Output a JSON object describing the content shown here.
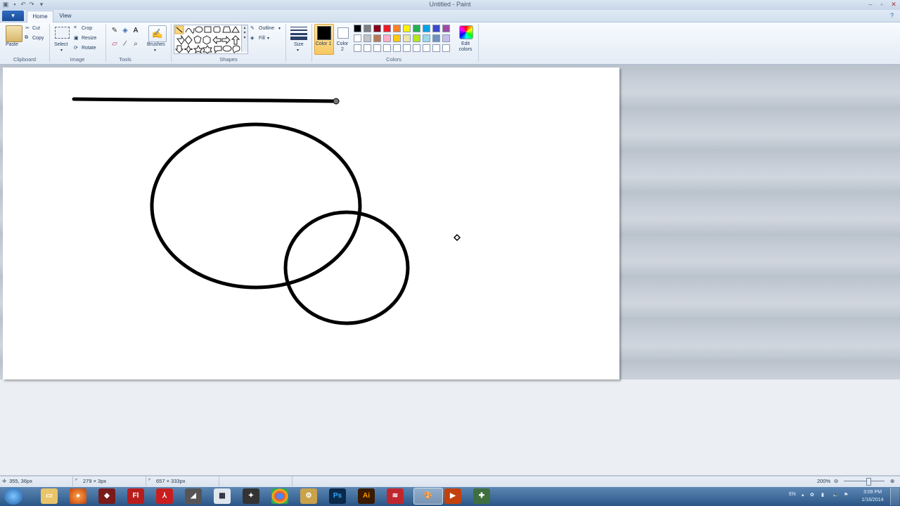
{
  "window": {
    "title": "Untitled - Paint"
  },
  "tabs": {
    "file_glyph": "▾",
    "home": "Home",
    "view": "View"
  },
  "ribbon": {
    "clipboard": {
      "label": "Clipboard",
      "paste": "Paste",
      "cut": "Cut",
      "copy": "Copy"
    },
    "image": {
      "label": "Image",
      "select": "Select",
      "crop": "Crop",
      "resize": "Resize",
      "rotate": "Rotate"
    },
    "tools": {
      "label": "Tools"
    },
    "brushes": {
      "label": "Brushes"
    },
    "shapes": {
      "label": "Shapes",
      "outline": "Outline",
      "fill": "Fill"
    },
    "size": {
      "label": "Size"
    },
    "colors": {
      "label": "Colors",
      "color1": "Color 1",
      "color2": "Color 2",
      "edit_colors": "Edit colors",
      "color1_value": "#000000",
      "color2_value": "#ffffff",
      "palette_row1": [
        "#000000",
        "#7f7f7f",
        "#880015",
        "#ed1c24",
        "#ff7f27",
        "#fff200",
        "#22b14c",
        "#00a2e8",
        "#3f48cc",
        "#a349a4"
      ],
      "palette_row2": [
        "#ffffff",
        "#c3c3c3",
        "#b97a57",
        "#ffaec9",
        "#ffc90e",
        "#efe4b0",
        "#b5e61d",
        "#99d9ea",
        "#7092be",
        "#c8bfe7"
      ],
      "palette_row3": [
        "#ffffff",
        "#ffffff",
        "#ffffff",
        "#ffffff",
        "#ffffff",
        "#ffffff",
        "#ffffff",
        "#ffffff",
        "#ffffff",
        "#ffffff"
      ]
    }
  },
  "status": {
    "cursor_pos": "355, 36px",
    "selection_size": "279 × 3px",
    "image_size": "657 × 333px",
    "zoom": "200%"
  },
  "taskbar": {
    "apps": [
      "start",
      "explorer",
      "firefox",
      "app",
      "flash",
      "acrobat",
      "app2",
      "calc",
      "unity",
      "chrome",
      "app3",
      "photoshop",
      "illustrator",
      "app4",
      "paint",
      "app5",
      "app6"
    ],
    "flash_label": "Fl",
    "ps_label": "Ps",
    "ai_label": "Ai",
    "time": "3:09 PM",
    "date": "1/16/2014",
    "lang": "EN"
  }
}
